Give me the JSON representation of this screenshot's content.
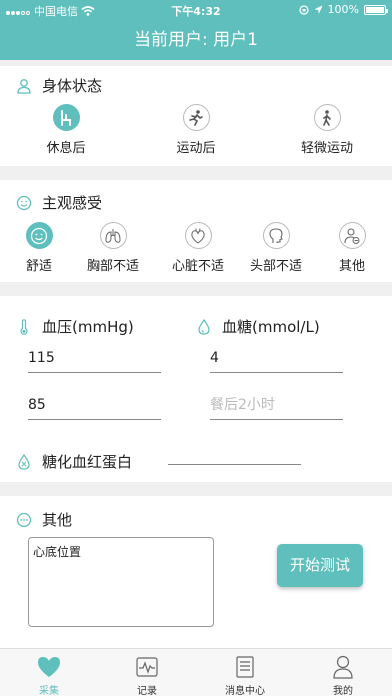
{
  "status_bar": {
    "carrier": "中国电信",
    "time": "下午4:32",
    "battery": "100%"
  },
  "nav": {
    "title": "当前用户: 用户1"
  },
  "body_state": {
    "title": "身体状态",
    "options": [
      {
        "label": "休息后",
        "icon": "rest-icon",
        "selected": true
      },
      {
        "label": "运动后",
        "icon": "running-icon",
        "selected": false
      },
      {
        "label": "轻微运动",
        "icon": "walking-icon",
        "selected": false
      }
    ]
  },
  "feeling": {
    "title": "主观感受",
    "options": [
      {
        "label": "舒适",
        "icon": "smile-icon",
        "selected": true
      },
      {
        "label": "胸部不适",
        "icon": "lungs-icon",
        "selected": false
      },
      {
        "label": "心脏不适",
        "icon": "heart-organ-icon",
        "selected": false
      },
      {
        "label": "头部不适",
        "icon": "head-icon",
        "selected": false
      },
      {
        "label": "其他",
        "icon": "person-other-icon",
        "selected": false
      }
    ]
  },
  "measure": {
    "bp_label": "血压(mmHg)",
    "bp_systolic": "115",
    "bp_diastolic": "85",
    "glucose_label": "血糖(mmol/L)",
    "glucose_value": "4",
    "glucose_after_placeholder": "餐后2小时",
    "hba1c_label": "糖化血红蛋白",
    "hba1c_value": ""
  },
  "other": {
    "title": "其他",
    "note": "心底位置",
    "start_button": "开始测试"
  },
  "tabbar": {
    "tabs": [
      {
        "label": "采集",
        "active": true
      },
      {
        "label": "记录",
        "active": false
      },
      {
        "label": "消息中心",
        "active": false
      },
      {
        "label": "我的",
        "active": false
      }
    ]
  },
  "colors": {
    "accent": "#5fbfbd",
    "background": "#f0f0f0"
  }
}
